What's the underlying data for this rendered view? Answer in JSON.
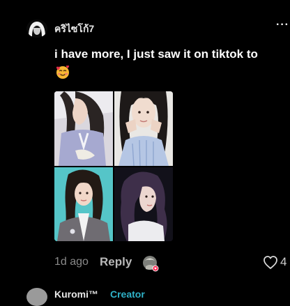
{
  "comment": {
    "username": "คริไซโก้7",
    "more_label": "···",
    "text": "i have more, I just saw it on tiktok to",
    "emoji_name": "smiling-face-with-hearts",
    "photos": [
      {
        "name": "girl-long-wavy-hair-blue-shirt"
      },
      {
        "name": "girl-hands-on-chin-blue-shirt"
      },
      {
        "name": "girl-wavy-hair-teal-background"
      },
      {
        "name": "girl-wavy-hair-dark-background"
      }
    ],
    "time_ago": "1d ago",
    "reply_label": "Reply",
    "like_count": "4"
  },
  "next_comment": {
    "username": "Kuromi™",
    "tag": "Creator"
  },
  "colors": {
    "background": "#000000",
    "creator_tag": "#2fb2c8",
    "meta_text": "#8a8a8a"
  }
}
